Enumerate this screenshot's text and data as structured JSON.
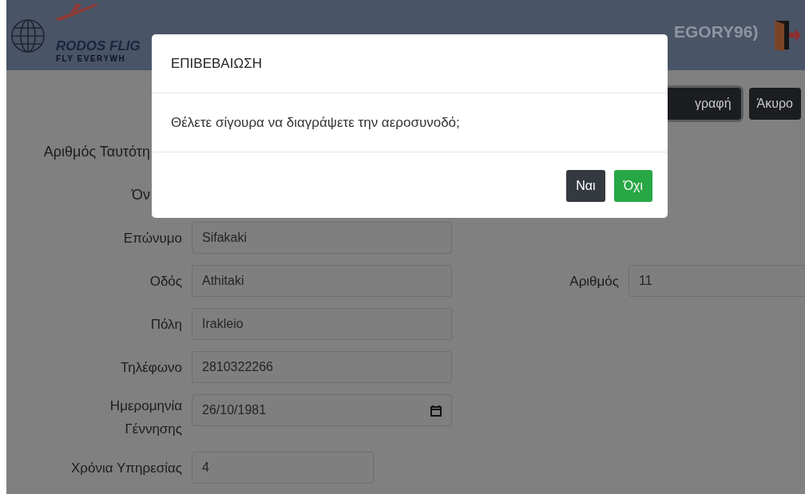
{
  "header": {
    "logo_title": "RODOS FLIG",
    "logo_tagline": "FLY EVERYWH",
    "user": "EGORY96)"
  },
  "actions": [
    {
      "label": "γραφή",
      "kind": "delete"
    },
    {
      "label": "Άκυρο",
      "kind": "cancel"
    }
  ],
  "form": {
    "rows": [
      {
        "label": "Αριθμός Ταυτότη",
        "kind": "hidden"
      },
      {
        "label": "Όν",
        "kind": "hidden"
      },
      {
        "label": "Επώνυμο",
        "kind": "text",
        "value": "Sifakaki"
      },
      {
        "label": "Οδός",
        "kind": "text",
        "value": "Athitaki",
        "side": {
          "label": "Αριθμός",
          "value": "11"
        }
      },
      {
        "label": "Πόλη",
        "kind": "text",
        "value": "Irakleio"
      },
      {
        "label": "Τηλέφωνο",
        "kind": "text",
        "value": "2810322266"
      },
      {
        "label": "Ημερομηνία Γέννησης",
        "kind": "date",
        "value": "26/10/1981"
      },
      {
        "label": "Χρόνια Υπηρεσίας",
        "kind": "short",
        "value": "4"
      }
    ]
  },
  "modal": {
    "title": "ΕΠΙΒΕΒΑΙΩΣΗ",
    "message": "Θέλετε σίγουρα να διαγράψετε την αεροσυνοδό;",
    "buttons": [
      {
        "label": "Ναι",
        "kind": "dark"
      },
      {
        "label": "Όχι",
        "kind": "success"
      }
    ]
  }
}
